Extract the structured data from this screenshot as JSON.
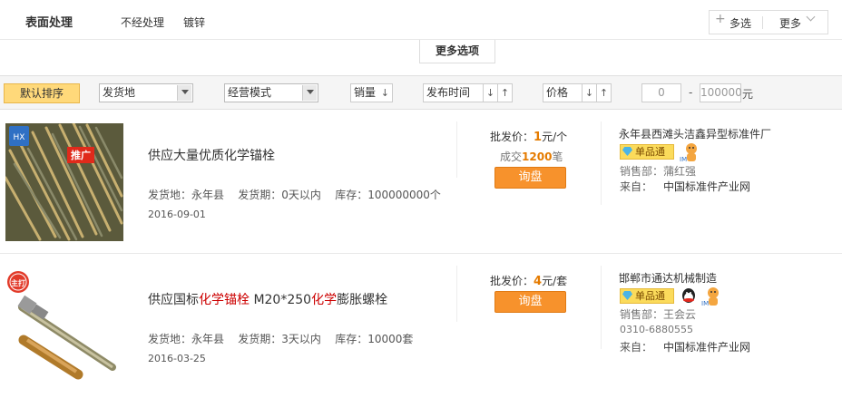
{
  "filter": {
    "title": "表面处理",
    "options": [
      "不经处理",
      "镀锌"
    ],
    "multi_label": "多选",
    "more_label": "更多"
  },
  "more_options_label": "更多选项",
  "sort_bar": {
    "default_label": "默认排序",
    "ship_from": "发货地",
    "business_mode": "经营模式",
    "sales_label": "销量",
    "publish_label": "发布时间",
    "price_label": "价格",
    "price_min": "0",
    "price_sep": "-",
    "price_max": "100000",
    "currency": "元"
  },
  "listings": [
    {
      "title_plain": "供应大量优质化学锚栓",
      "ship_from": "发货地：永年县",
      "lead_time": "发货期：0天以内",
      "stock": "库存：100000000个",
      "date": "2016-09-01",
      "price_prefix": "批发价：",
      "price": "1",
      "price_unit": "元/个",
      "deal_prefix": "成交",
      "deal_count": "1200",
      "deal_unit": "笔",
      "inquiry": "询盘",
      "company": "永年县西滩头洁鑫异型标准件厂",
      "badge": "单品通",
      "sales_dept": "销售部：蒲红强",
      "from_label": "来自：",
      "from_value": "中国标准件产业网",
      "thumb_tag": "推广",
      "thumb_logo": "HX"
    },
    {
      "title_parts": [
        "供应国标",
        "化学锚栓",
        " M20*250",
        "化学",
        "膨胀螺栓"
      ],
      "ship_from": "发货地：永年县",
      "lead_time": "发货期：3天以内",
      "stock": "库存：10000套",
      "date": "2016-03-25",
      "price_prefix": "批发价：",
      "price": "4",
      "price_unit": "元/套",
      "inquiry": "询盘",
      "company": "邯郸市通达机械制造",
      "badge": "单品通",
      "sales_dept": "销售部：王会云",
      "phone": "0310-6880555",
      "from_label": "来自：",
      "from_value": "中国标准件产业网",
      "thumb_stamp": "主打"
    }
  ],
  "colors": {
    "accent_orange": "#f7922c",
    "price_orange": "#e57b00",
    "highlight_red": "#cc0000",
    "sort_active": "#ffd97a"
  }
}
